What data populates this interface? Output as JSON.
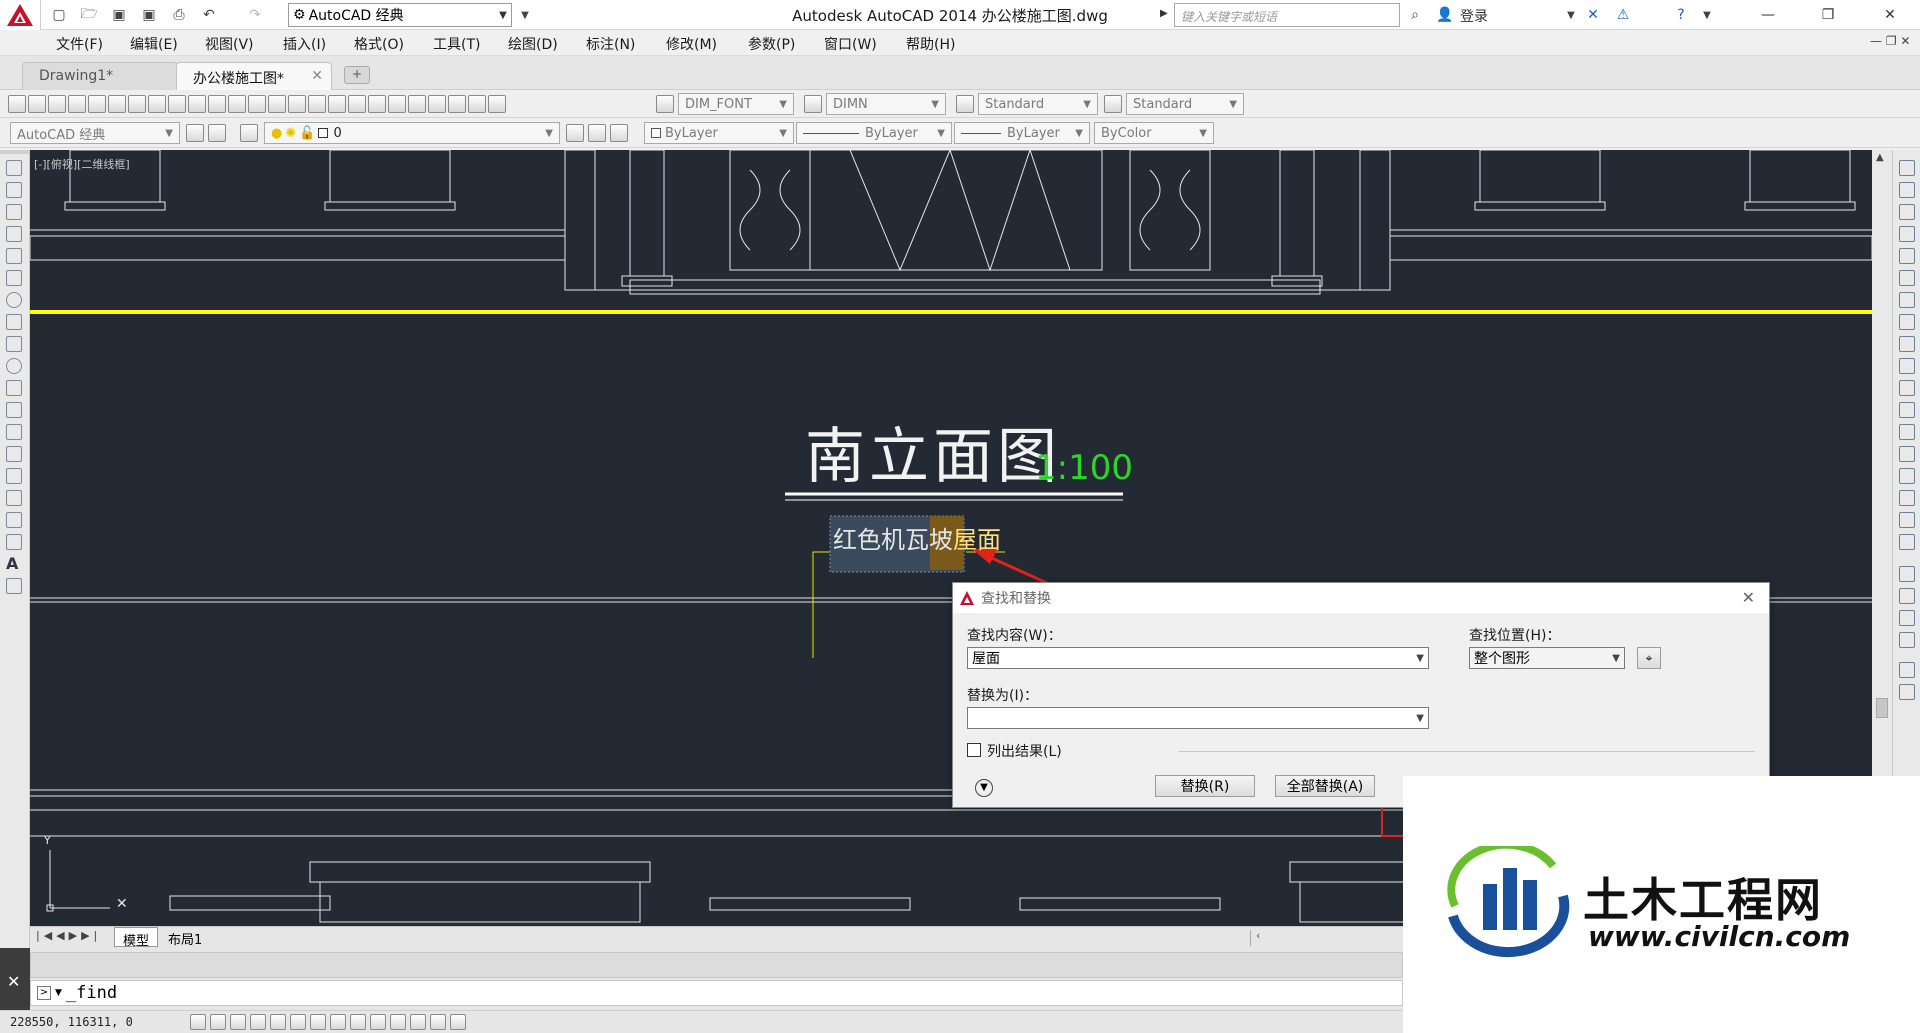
{
  "titlebar": {
    "workspace": "AutoCAD 经典",
    "window_title": "Autodesk AutoCAD 2014    办公楼施工图.dwg",
    "search_placeholder": "键入关键字或短语",
    "login": "登录"
  },
  "menu": [
    "文件(F)",
    "编辑(E)",
    "视图(V)",
    "插入(I)",
    "格式(O)",
    "工具(T)",
    "绘图(D)",
    "标注(N)",
    "修改(M)",
    "参数(P)",
    "窗口(W)",
    "帮助(H)"
  ],
  "doc_tabs": [
    {
      "label": "Drawing1*",
      "active": false
    },
    {
      "label": "办公楼施工图*",
      "active": true
    }
  ],
  "styles_toolbar": {
    "text_style": "DIM_FONT",
    "dim_style": "DIMN",
    "table_style": "Standard",
    "multileader_style": "Standard"
  },
  "layers_toolbar": {
    "workspace": "AutoCAD 经典",
    "layer": "0",
    "color": "ByLayer",
    "linetype": "ByLayer",
    "lineweight": "ByLayer",
    "plotstyle": "ByColor"
  },
  "viewport_label": "[-][俯视][二维线框]",
  "drawing": {
    "title": "南立面图",
    "scale": "1:100",
    "annotation_prefix": "红色机瓦坡",
    "annotation_highlight": "屋面"
  },
  "layout_tabs": [
    "模型",
    "布局1"
  ],
  "command": {
    "text": "_find"
  },
  "status": {
    "coords": "228550, 116311, 0"
  },
  "dialog": {
    "title": "查找和替换",
    "find_label": "查找内容(W)：",
    "find_value": "屋面",
    "replace_label": "替换为(I)：",
    "replace_value": "",
    "find_where_label": "查找位置(H)：",
    "find_where_value": "整个图形",
    "list_results_label": "列出结果(L)",
    "replace_button": "替换(R)",
    "replace_all_button": "全部替换(A)"
  },
  "watermark": {
    "title": "土木工程网",
    "url": "www.civilcn.com"
  },
  "colors": {
    "canvas": "#232a34",
    "highlight_line": "#ffff00",
    "scale_text": "#2bd62b",
    "arrow": "#e0231c",
    "accent_red": "#c8102e"
  }
}
